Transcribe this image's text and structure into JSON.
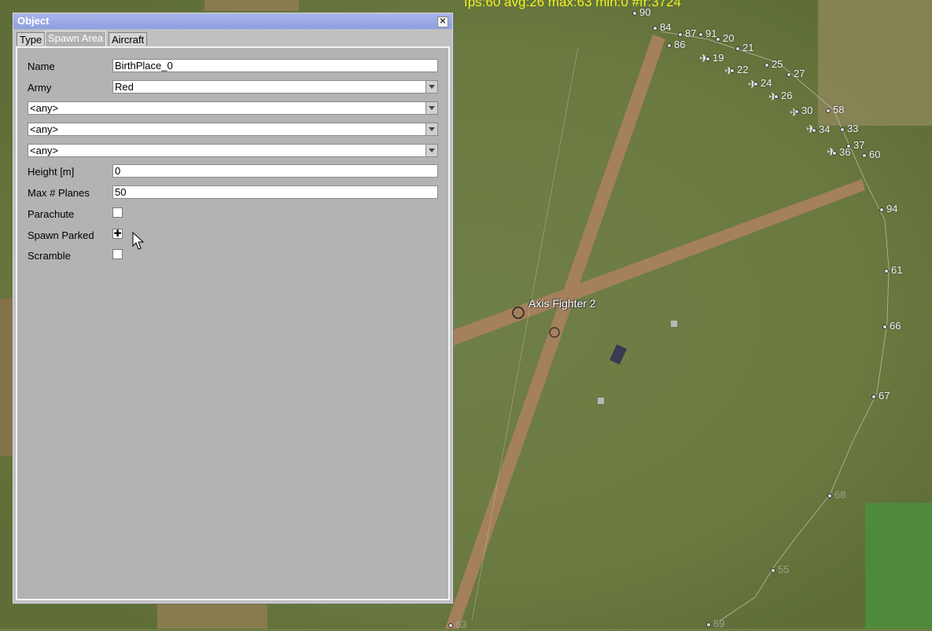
{
  "map": {
    "fps_text": "fps:60 avg:26 max:63 min:0 #fr:3724",
    "object_label": "Axis Fighter 2",
    "waypoints": [
      {
        "label": "90"
      },
      {
        "label": "84"
      },
      {
        "label": "87"
      },
      {
        "label": "91"
      },
      {
        "label": "20"
      },
      {
        "label": "21"
      },
      {
        "label": "86"
      },
      {
        "label": "19"
      },
      {
        "label": "25"
      },
      {
        "label": "27"
      },
      {
        "label": "22"
      },
      {
        "label": "24"
      },
      {
        "label": "26"
      },
      {
        "label": "30"
      },
      {
        "label": "58"
      },
      {
        "label": "34"
      },
      {
        "label": "33"
      },
      {
        "label": "37"
      },
      {
        "label": "36"
      },
      {
        "label": "60"
      },
      {
        "label": "94"
      },
      {
        "label": "61"
      },
      {
        "label": "66"
      },
      {
        "label": "67"
      },
      {
        "label": "68"
      },
      {
        "label": "69"
      },
      {
        "label": "63"
      },
      {
        "label": "55"
      }
    ]
  },
  "dialog": {
    "title": "Object",
    "close_glyph": "✕",
    "tabs": [
      {
        "label": "Type"
      },
      {
        "label": "Spawn Area",
        "active": true
      },
      {
        "label": "Aircraft"
      }
    ],
    "fields": {
      "name": {
        "label": "Name",
        "value": "BirthPlace_0"
      },
      "army": {
        "label": "Army",
        "value": "Red"
      },
      "filter1": {
        "value": "<any>"
      },
      "filter2": {
        "value": "<any>"
      },
      "filter3": {
        "value": "<any>"
      },
      "height": {
        "label": "Height [m]",
        "value": "0"
      },
      "max_planes": {
        "label": "Max # Planes",
        "value": "50"
      },
      "parachute": {
        "label": "Parachute",
        "checked": false
      },
      "spawn_parked": {
        "label": "Spawn Parked",
        "checked": true,
        "mark": "✚"
      },
      "scramble": {
        "label": "Scramble",
        "checked": false
      }
    }
  },
  "colors": {
    "titlebar": "#9aa9e4",
    "panel": "#b3b3b3",
    "fps": "#f0f020",
    "grass": "#6e7e45",
    "runway": "#a5805c"
  }
}
